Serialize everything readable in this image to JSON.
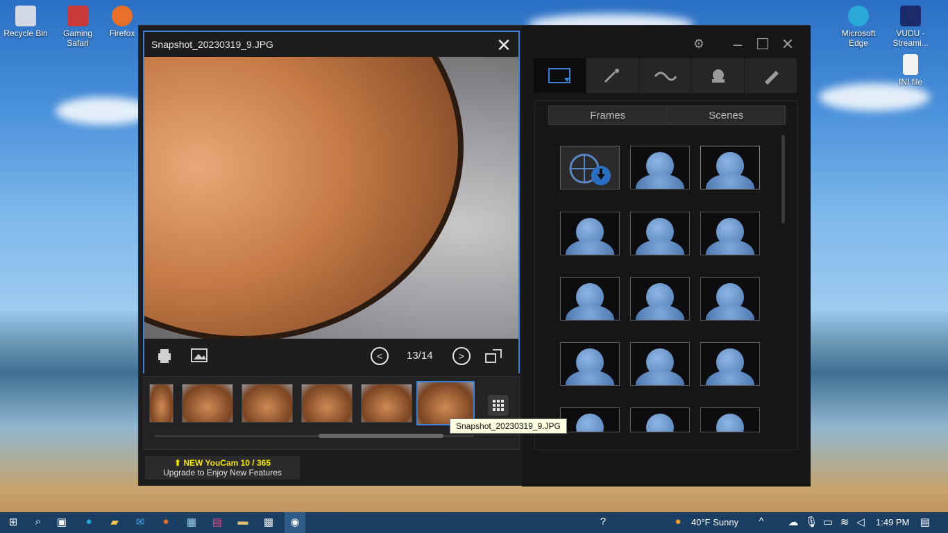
{
  "desktop": {
    "icons": [
      {
        "label": "Recycle Bin",
        "icon": "recycle-bin-icon"
      },
      {
        "label": "Gaming Safari",
        "icon": "gaming-safari-icon"
      },
      {
        "label": "Firefox",
        "icon": "firefox-icon"
      },
      {
        "label": "Microsoft Edge",
        "icon": "edge-icon"
      },
      {
        "label": "VUDU - Streami...",
        "icon": "vudu-icon"
      },
      {
        "label": "INI file",
        "icon": "ini-file-icon"
      }
    ]
  },
  "viewer": {
    "title": "Snapshot_20230319_9.JPG",
    "counter": "13/14",
    "tooltip": "Snapshot_20230319_9.JPG"
  },
  "panel": {
    "tabs": [
      "Frames",
      "Scenes"
    ],
    "tools": [
      "frame-tool-icon",
      "magic-effects-icon",
      "particle-effects-icon",
      "avatar-effects-icon",
      "draw-icon"
    ]
  },
  "promo": {
    "line1": "NEW YouCam 10 / 365",
    "line2": "Upgrade to Enjoy New Features"
  },
  "taskbar": {
    "weather": "40°F  Sunny",
    "time": "1:49 PM"
  },
  "colors": {
    "accent": "#3d7fd6",
    "promo_yellow": "#f4e400"
  }
}
